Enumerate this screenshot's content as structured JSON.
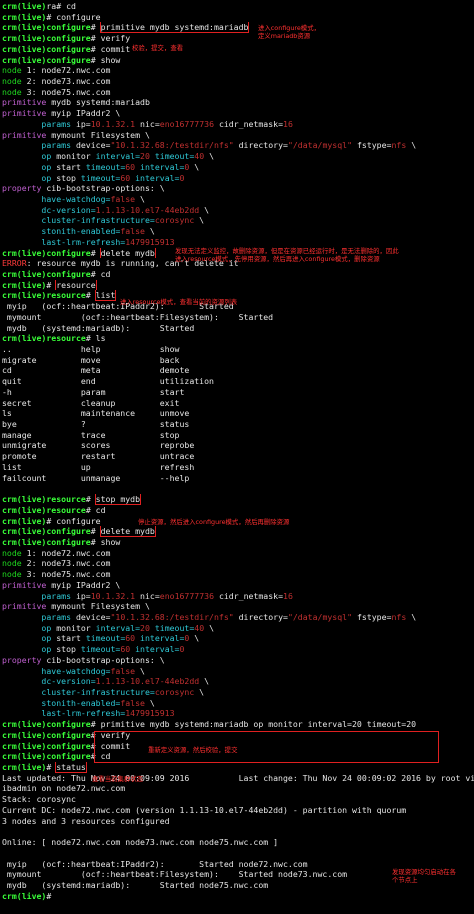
{
  "colors": {
    "prompt": "#1fd81f",
    "keyword": "#c060d0",
    "value": "#e6d23a",
    "attr": "#2fc9d6",
    "error": "#ff3a3a",
    "annotation": "#ff3030",
    "background": "#000000"
  },
  "lines": [
    [
      {
        "t": "crm(live)",
        "c": "bgreen"
      },
      {
        "t": "ra# ",
        "c": "white"
      },
      {
        "t": "cd",
        "c": "white"
      }
    ],
    [
      {
        "t": "crm(live)",
        "c": "bgreen"
      },
      {
        "t": "# configure",
        "c": "white"
      }
    ],
    [
      {
        "t": "crm(live)configure",
        "c": "bgreen"
      },
      {
        "t": "# ",
        "c": "white"
      },
      {
        "t": "primitive mydb systemd:mariadb",
        "c": "white",
        "box": true
      }
    ],
    [
      {
        "t": "crm(live)configure",
        "c": "bgreen"
      },
      {
        "t": "# verify",
        "c": "white"
      }
    ],
    [
      {
        "t": "crm(live)configure",
        "c": "bgreen"
      },
      {
        "t": "# commit",
        "c": "white"
      }
    ],
    [
      {
        "t": "crm(live)configure",
        "c": "bgreen"
      },
      {
        "t": "# show",
        "c": "white"
      }
    ],
    [
      {
        "t": "node ",
        "c": "green"
      },
      {
        "t": "1: node72.nwc.com",
        "c": "white"
      }
    ],
    [
      {
        "t": "node ",
        "c": "green"
      },
      {
        "t": "2: node73.nwc.com",
        "c": "white"
      }
    ],
    [
      {
        "t": "node ",
        "c": "green"
      },
      {
        "t": "3: node75.nwc.com",
        "c": "white"
      }
    ],
    [
      {
        "t": "primitive ",
        "c": "purple"
      },
      {
        "t": "mydb systemd:mariadb",
        "c": "white"
      }
    ],
    [
      {
        "t": "primitive ",
        "c": "purple"
      },
      {
        "t": "myip IPaddr2 \\",
        "c": "white"
      }
    ],
    [
      {
        "t": "        params ",
        "c": "cyan"
      },
      {
        "t": "ip=",
        "c": "white"
      },
      {
        "t": "10.1.32.1",
        "c": "dimred"
      },
      {
        "t": " nic=",
        "c": "white"
      },
      {
        "t": "eno16777736",
        "c": "dimred"
      },
      {
        "t": " cidr_netmask=",
        "c": "white"
      },
      {
        "t": "16",
        "c": "dimred"
      }
    ],
    [
      {
        "t": "primitive ",
        "c": "purple"
      },
      {
        "t": "mymount Filesystem \\",
        "c": "white"
      }
    ],
    [
      {
        "t": "        params ",
        "c": "cyan"
      },
      {
        "t": "device=",
        "c": "white"
      },
      {
        "t": "\"10.1.32.68:/testdir/nfs\"",
        "c": "dimred"
      },
      {
        "t": " directory=",
        "c": "white"
      },
      {
        "t": "\"/data/mysql\"",
        "c": "dimred"
      },
      {
        "t": " fstype=",
        "c": "white"
      },
      {
        "t": "nfs",
        "c": "dimred"
      },
      {
        "t": " \\",
        "c": "white"
      }
    ],
    [
      {
        "t": "        op ",
        "c": "cyan"
      },
      {
        "t": "monitor ",
        "c": "white"
      },
      {
        "t": "interval=",
        "c": "cyan"
      },
      {
        "t": "20",
        "c": "dimred"
      },
      {
        "t": " timeout=",
        "c": "cyan"
      },
      {
        "t": "40",
        "c": "dimred"
      },
      {
        "t": " \\",
        "c": "white"
      }
    ],
    [
      {
        "t": "        op ",
        "c": "cyan"
      },
      {
        "t": "start ",
        "c": "white"
      },
      {
        "t": "timeout=",
        "c": "cyan"
      },
      {
        "t": "60",
        "c": "dimred"
      },
      {
        "t": " interval=",
        "c": "cyan"
      },
      {
        "t": "0",
        "c": "dimred"
      },
      {
        "t": " \\",
        "c": "white"
      }
    ],
    [
      {
        "t": "        op ",
        "c": "cyan"
      },
      {
        "t": "stop ",
        "c": "white"
      },
      {
        "t": "timeout=",
        "c": "cyan"
      },
      {
        "t": "60",
        "c": "dimred"
      },
      {
        "t": " interval=",
        "c": "cyan"
      },
      {
        "t": "0",
        "c": "dimred"
      }
    ],
    [
      {
        "t": "property ",
        "c": "purple"
      },
      {
        "t": "cib-bootstrap-options: \\",
        "c": "white"
      }
    ],
    [
      {
        "t": "        have-watchdog=",
        "c": "cyan"
      },
      {
        "t": "false",
        "c": "dimred"
      },
      {
        "t": " \\",
        "c": "white"
      }
    ],
    [
      {
        "t": "        dc-version=",
        "c": "cyan"
      },
      {
        "t": "1.1.13-10.el7-44eb2dd",
        "c": "dimred"
      },
      {
        "t": " \\",
        "c": "white"
      }
    ],
    [
      {
        "t": "        cluster-infrastructure=",
        "c": "cyan"
      },
      {
        "t": "corosync",
        "c": "dimred"
      },
      {
        "t": " \\",
        "c": "white"
      }
    ],
    [
      {
        "t": "        stonith-enabled=",
        "c": "cyan"
      },
      {
        "t": "false",
        "c": "dimred"
      },
      {
        "t": " \\",
        "c": "white"
      }
    ],
    [
      {
        "t": "        last-lrm-refresh=",
        "c": "cyan"
      },
      {
        "t": "1479915913",
        "c": "dimred"
      }
    ],
    [
      {
        "t": "crm(live)configure",
        "c": "bgreen"
      },
      {
        "t": "# ",
        "c": "white"
      },
      {
        "t": "delete mydb",
        "c": "white",
        "box": true
      }
    ],
    [
      {
        "t": "ERROR",
        "c": "red"
      },
      {
        "t": ": resource mydb is running, can't delete it",
        "c": "white"
      }
    ],
    [
      {
        "t": "crm(live)configure",
        "c": "bgreen"
      },
      {
        "t": "# cd",
        "c": "white"
      }
    ],
    [
      {
        "t": "crm(live)",
        "c": "bgreen"
      },
      {
        "t": "# ",
        "c": "white"
      },
      {
        "t": "resource",
        "c": "white",
        "box": true
      }
    ],
    [
      {
        "t": "crm(live)resource",
        "c": "bgreen"
      },
      {
        "t": "# ",
        "c": "white"
      },
      {
        "t": "list",
        "c": "white",
        "box": true
      }
    ],
    [
      {
        "t": " myip   (ocf::heartbeat:IPaddr2):       Started",
        "c": "white"
      }
    ],
    [
      {
        "t": " mymount        (ocf::heartbeat:Filesystem):    Started",
        "c": "white"
      }
    ],
    [
      {
        "t": " mydb   (systemd:mariadb):      Started",
        "c": "white"
      }
    ],
    [
      {
        "t": "crm(live)resource",
        "c": "bgreen"
      },
      {
        "t": "# ls",
        "c": "white"
      }
    ],
    [
      {
        "t": "..              help            show",
        "c": "white"
      }
    ],
    [
      {
        "t": "migrate         move            back",
        "c": "white"
      }
    ],
    [
      {
        "t": "cd              meta            demote",
        "c": "white"
      }
    ],
    [
      {
        "t": "quit            end             utilization",
        "c": "white"
      }
    ],
    [
      {
        "t": "-h              param           start",
        "c": "white"
      }
    ],
    [
      {
        "t": "secret          cleanup         exit",
        "c": "white"
      }
    ],
    [
      {
        "t": "ls              maintenance     unmove",
        "c": "white"
      }
    ],
    [
      {
        "t": "bye             ?               status",
        "c": "white"
      }
    ],
    [
      {
        "t": "manage          trace           stop",
        "c": "white"
      }
    ],
    [
      {
        "t": "unmigrate       scores          reprobe",
        "c": "white"
      }
    ],
    [
      {
        "t": "promote         restart         untrace",
        "c": "white"
      }
    ],
    [
      {
        "t": "list            up              refresh",
        "c": "white"
      }
    ],
    [
      {
        "t": "failcount       unmanage        --help",
        "c": "white"
      }
    ],
    [
      {
        "t": "",
        "c": "white"
      }
    ],
    [
      {
        "t": "crm(live)resource",
        "c": "bgreen"
      },
      {
        "t": "# ",
        "c": "white"
      },
      {
        "t": "stop mydb",
        "c": "white",
        "box": true
      }
    ],
    [
      {
        "t": "crm(live)resource",
        "c": "bgreen"
      },
      {
        "t": "# cd",
        "c": "white"
      }
    ],
    [
      {
        "t": "crm(live)",
        "c": "bgreen"
      },
      {
        "t": "# configure",
        "c": "white"
      }
    ],
    [
      {
        "t": "crm(live)configure",
        "c": "bgreen"
      },
      {
        "t": "# ",
        "c": "white"
      },
      {
        "t": "delete mydb",
        "c": "white",
        "box": true
      }
    ],
    [
      {
        "t": "crm(live)configure",
        "c": "bgreen"
      },
      {
        "t": "# show",
        "c": "white"
      }
    ],
    [
      {
        "t": "node ",
        "c": "green"
      },
      {
        "t": "1: node72.nwc.com",
        "c": "white"
      }
    ],
    [
      {
        "t": "node ",
        "c": "green"
      },
      {
        "t": "2: node73.nwc.com",
        "c": "white"
      }
    ],
    [
      {
        "t": "node ",
        "c": "green"
      },
      {
        "t": "3: node75.nwc.com",
        "c": "white"
      }
    ],
    [
      {
        "t": "primitive ",
        "c": "purple"
      },
      {
        "t": "myip IPaddr2 \\",
        "c": "white"
      }
    ],
    [
      {
        "t": "        params ",
        "c": "cyan"
      },
      {
        "t": "ip=",
        "c": "white"
      },
      {
        "t": "10.1.32.1",
        "c": "dimred"
      },
      {
        "t": " nic=",
        "c": "white"
      },
      {
        "t": "eno16777736",
        "c": "dimred"
      },
      {
        "t": " cidr_netmask=",
        "c": "white"
      },
      {
        "t": "16",
        "c": "dimred"
      }
    ],
    [
      {
        "t": "primitive ",
        "c": "purple"
      },
      {
        "t": "mymount Filesystem \\",
        "c": "white"
      }
    ],
    [
      {
        "t": "        params ",
        "c": "cyan"
      },
      {
        "t": "device=",
        "c": "white"
      },
      {
        "t": "\"10.1.32.68:/testdir/nfs\"",
        "c": "dimred"
      },
      {
        "t": " directory=",
        "c": "white"
      },
      {
        "t": "\"/data/mysql\"",
        "c": "dimred"
      },
      {
        "t": " fstype=",
        "c": "white"
      },
      {
        "t": "nfs",
        "c": "dimred"
      },
      {
        "t": " \\",
        "c": "white"
      }
    ],
    [
      {
        "t": "        op ",
        "c": "cyan"
      },
      {
        "t": "monitor ",
        "c": "white"
      },
      {
        "t": "interval=",
        "c": "cyan"
      },
      {
        "t": "20",
        "c": "dimred"
      },
      {
        "t": " timeout=",
        "c": "cyan"
      },
      {
        "t": "40",
        "c": "dimred"
      },
      {
        "t": " \\",
        "c": "white"
      }
    ],
    [
      {
        "t": "        op ",
        "c": "cyan"
      },
      {
        "t": "start ",
        "c": "white"
      },
      {
        "t": "timeout=",
        "c": "cyan"
      },
      {
        "t": "60",
        "c": "dimred"
      },
      {
        "t": " interval=",
        "c": "cyan"
      },
      {
        "t": "0",
        "c": "dimred"
      },
      {
        "t": " \\",
        "c": "white"
      }
    ],
    [
      {
        "t": "        op ",
        "c": "cyan"
      },
      {
        "t": "stop ",
        "c": "white"
      },
      {
        "t": "timeout=",
        "c": "cyan"
      },
      {
        "t": "60",
        "c": "dimred"
      },
      {
        "t": " interval=",
        "c": "cyan"
      },
      {
        "t": "0",
        "c": "dimred"
      }
    ],
    [
      {
        "t": "property ",
        "c": "purple"
      },
      {
        "t": "cib-bootstrap-options: \\",
        "c": "white"
      }
    ],
    [
      {
        "t": "        have-watchdog=",
        "c": "cyan"
      },
      {
        "t": "false",
        "c": "dimred"
      },
      {
        "t": " \\",
        "c": "white"
      }
    ],
    [
      {
        "t": "        dc-version=",
        "c": "cyan"
      },
      {
        "t": "1.1.13-10.el7-44eb2dd",
        "c": "dimred"
      },
      {
        "t": " \\",
        "c": "white"
      }
    ],
    [
      {
        "t": "        cluster-infrastructure=",
        "c": "cyan"
      },
      {
        "t": "corosync",
        "c": "dimred"
      },
      {
        "t": " \\",
        "c": "white"
      }
    ],
    [
      {
        "t": "        stonith-enabled=",
        "c": "cyan"
      },
      {
        "t": "false",
        "c": "dimred"
      },
      {
        "t": " \\",
        "c": "white"
      }
    ],
    [
      {
        "t": "        last-lrm-refresh=",
        "c": "cyan"
      },
      {
        "t": "1479915913",
        "c": "dimred"
      }
    ],
    [
      {
        "t": "crm(live)configure",
        "c": "bgreen"
      },
      {
        "t": "# primitive mydb systemd:mariadb op monitor interval=20 timeout=20",
        "c": "white"
      }
    ],
    [
      {
        "t": "crm(live)configure",
        "c": "bgreen"
      },
      {
        "t": "# verify",
        "c": "white"
      }
    ],
    [
      {
        "t": "crm(live)configure",
        "c": "bgreen"
      },
      {
        "t": "# commit",
        "c": "white"
      }
    ],
    [
      {
        "t": "crm(live)configure",
        "c": "bgreen"
      },
      {
        "t": "# cd",
        "c": "white"
      }
    ],
    [
      {
        "t": "crm(live)",
        "c": "bgreen"
      },
      {
        "t": "# ",
        "c": "white"
      },
      {
        "t": "status",
        "c": "white",
        "box": true
      }
    ],
    [
      {
        "t": "Last updated: Thu Nov 24 00:09:09 2016          Last change: Thu Nov 24 00:09:02 2016 by root via c",
        "c": "white"
      }
    ],
    [
      {
        "t": "ibadmin on node72.nwc.com",
        "c": "white"
      }
    ],
    [
      {
        "t": "Stack: corosync",
        "c": "white"
      }
    ],
    [
      {
        "t": "Current DC: node72.nwc.com (version 1.1.13-10.el7-44eb2dd) - partition with quorum",
        "c": "white"
      }
    ],
    [
      {
        "t": "3 nodes and 3 resources configured",
        "c": "white"
      }
    ],
    [
      {
        "t": "",
        "c": "white"
      }
    ],
    [
      {
        "t": "Online: [ node72.nwc.com node73.nwc.com node75.nwc.com ]",
        "c": "white"
      }
    ],
    [
      {
        "t": "",
        "c": "white"
      }
    ],
    [
      {
        "t": " myip   (ocf::heartbeat:IPaddr2):       Started node72.nwc.com",
        "c": "white"
      }
    ],
    [
      {
        "t": " mymount        (ocf::heartbeat:Filesystem):    Started node73.nwc.com",
        "c": "white"
      }
    ],
    [
      {
        "t": " mydb   (systemd:mariadb):      Started node75.nwc.com",
        "c": "white"
      }
    ],
    [
      {
        "t": "crm(live)",
        "c": "bgreen"
      },
      {
        "t": "# ",
        "c": "white"
      }
    ]
  ],
  "annotations": {
    "note_add_resource": "进入configure模式，\n定义mariadb资源",
    "note_verify_commit": "校验，提交，查看",
    "note_running_delete": "发现无法定义监控，故删除资源，但是在资源已经运行时，是无法删除的，因此\n进入resource模式，先停用资源，然后再进入configure模式，删除资源",
    "note_resource_list": "进入resource模式，查看当前的资源列表",
    "note_stop_delete": "停止资源，然后进入configure模式，然后再删除资源",
    "note_redefine": "重新定义资源，然后校验，提交",
    "note_status": "查看当前集群状态",
    "note_started": "发现资源均匀启动在各\n个节点上"
  }
}
